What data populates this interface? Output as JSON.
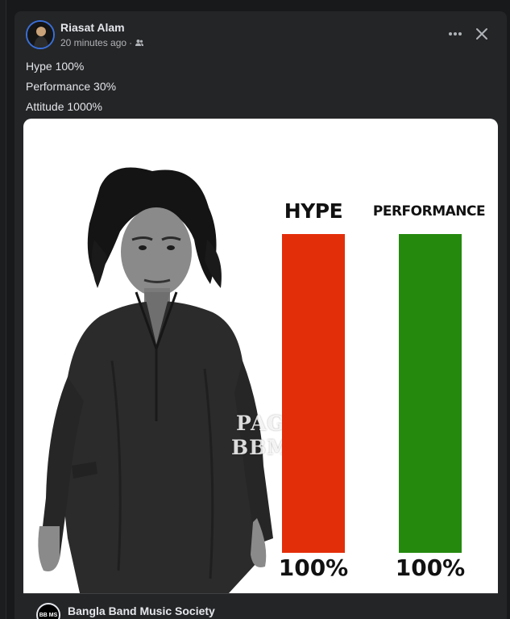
{
  "post": {
    "author": "Riasat Alam",
    "time": "20 minutes ago",
    "separator": "·",
    "audience_icon": "friends-icon",
    "lines": [
      "Hype 100%",
      "Performance 30%",
      "Attitude 1000%"
    ]
  },
  "meme": {
    "watermark_line1": "PAGE",
    "watermark_line2": "BBMS",
    "hype_label": "HYPE",
    "performance_label": "PERFORMANCE",
    "hype_pct": "100%",
    "performance_pct": "100%",
    "hype_color": "#e32e0a",
    "performance_color": "#25890e"
  },
  "shared_from": {
    "page_name": "Bangla Band Music Society",
    "logo_text": "BB MS"
  },
  "chart_data": {
    "type": "bar",
    "categories": [
      "HYPE",
      "PERFORMANCE"
    ],
    "values": [
      100,
      100
    ],
    "data_labels": [
      "100%",
      "100%"
    ],
    "colors": [
      "#e32e0a",
      "#25890e"
    ],
    "ylim": [
      0,
      100
    ]
  }
}
